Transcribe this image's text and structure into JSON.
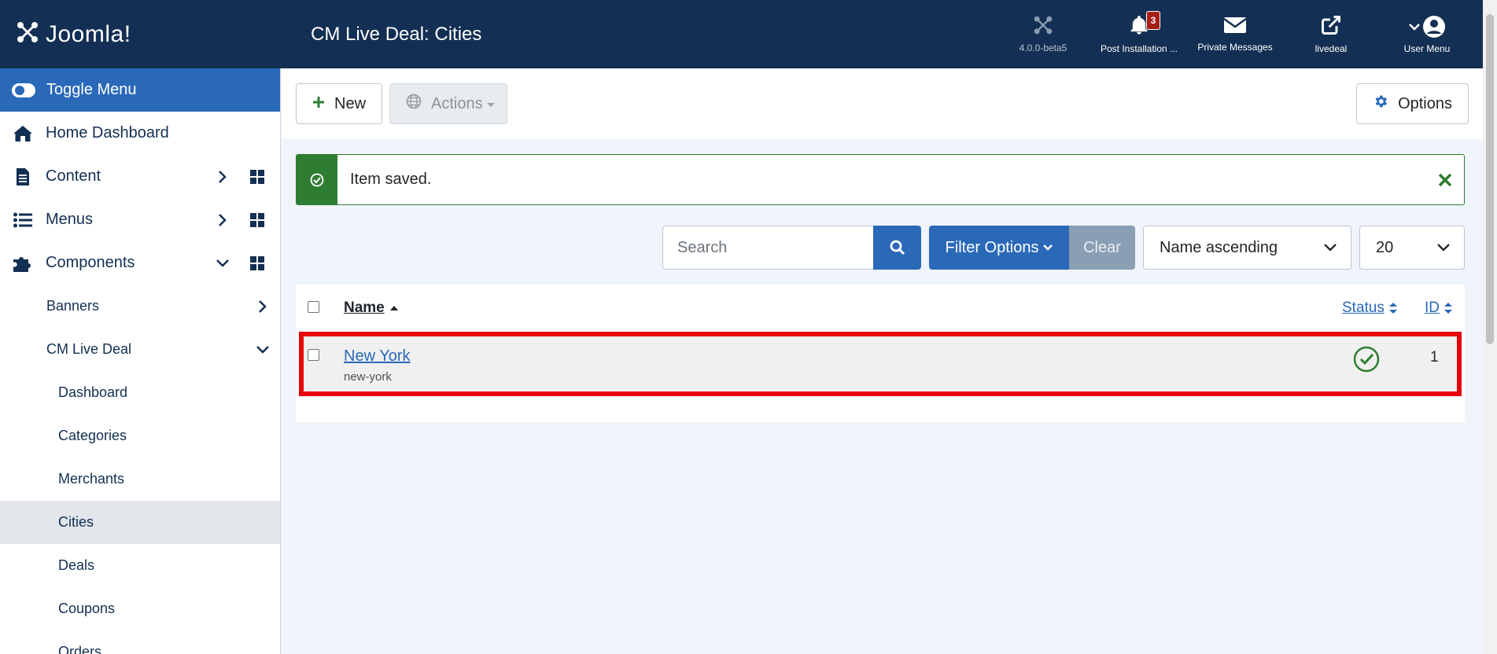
{
  "header": {
    "brand": "Joomla!",
    "title": "CM Live Deal: Cities",
    "actions": [
      {
        "label": "4.0.0-beta5",
        "icon": "joomla-icon"
      },
      {
        "label": "Post Installation ...",
        "icon": "bell-icon",
        "badge": "3"
      },
      {
        "label": "Private Messages",
        "icon": "envelope-icon"
      },
      {
        "label": "livedeal",
        "icon": "external-link-icon"
      },
      {
        "label": "User Menu",
        "icon": "user-icon"
      }
    ]
  },
  "sidebar": {
    "toggle_label": "Toggle Menu",
    "items": [
      {
        "label": "Home Dashboard"
      },
      {
        "label": "Content"
      },
      {
        "label": "Menus"
      },
      {
        "label": "Components"
      }
    ],
    "components_sub": [
      {
        "label": "Banners"
      },
      {
        "label": "CM Live Deal"
      }
    ],
    "livedeal_sub": [
      {
        "label": "Dashboard"
      },
      {
        "label": "Categories"
      },
      {
        "label": "Merchants"
      },
      {
        "label": "Cities",
        "active": true
      },
      {
        "label": "Deals"
      },
      {
        "label": "Coupons"
      },
      {
        "label": "Orders"
      }
    ]
  },
  "toolbar": {
    "new_label": "New",
    "actions_label": "Actions",
    "options_label": "Options"
  },
  "alert": {
    "message": "Item saved."
  },
  "filters": {
    "search_placeholder": "Search",
    "filter_options_label": "Filter Options",
    "clear_label": "Clear",
    "ordering": "Name ascending",
    "limit": "20"
  },
  "table": {
    "columns": {
      "name": "Name",
      "status": "Status",
      "id": "ID"
    },
    "rows": [
      {
        "name": "New York",
        "alias": "new-york",
        "status": "published",
        "id": "1"
      }
    ]
  },
  "colors": {
    "header_bg": "#132f53",
    "primary": "#2a69b8",
    "success": "#2f7d32",
    "highlight": "#e8000d"
  }
}
